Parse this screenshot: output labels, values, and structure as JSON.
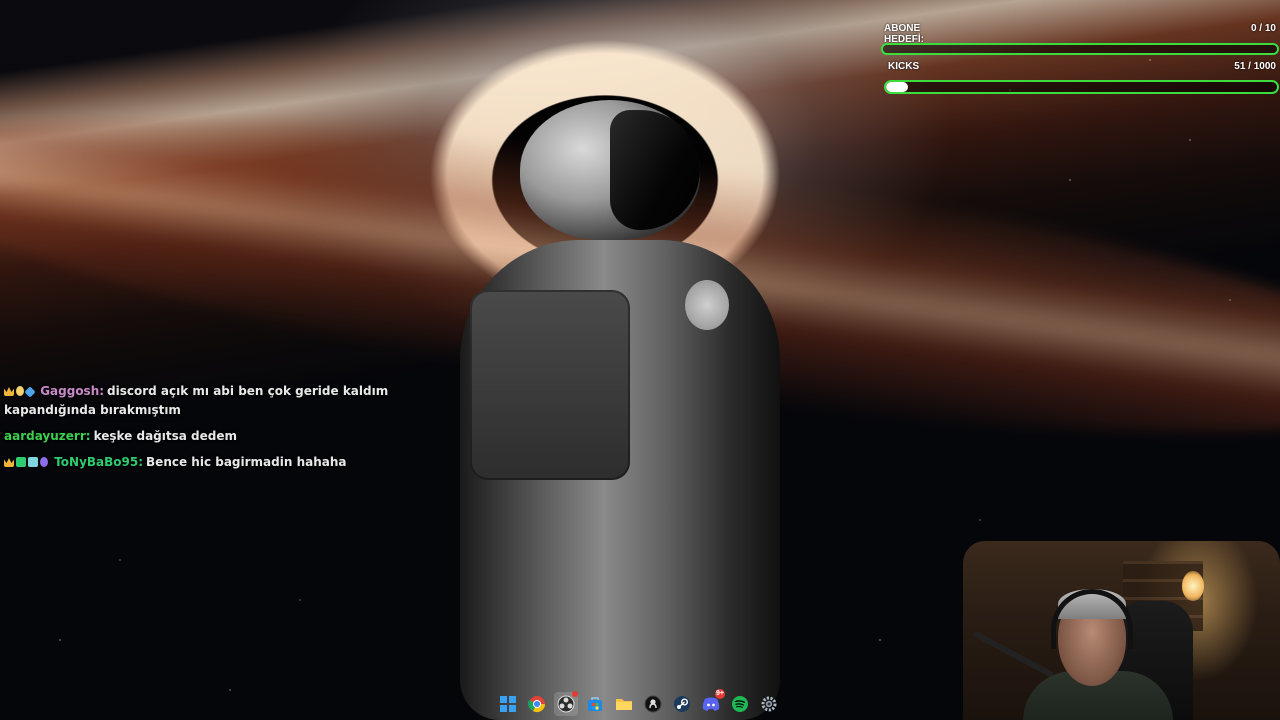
{
  "goals": [
    {
      "label": "ABONE HEDEFİ:",
      "count": "0 / 10",
      "progress": 0.0
    },
    {
      "label": "KICKS",
      "count": "51 / 1000",
      "progress": 0.051
    }
  ],
  "chat": {
    "messages": [
      {
        "username": "Gaggosh:",
        "username_color": "#c98ac9",
        "badges": [
          "crown-icon",
          "drop-icon",
          "gem-icon"
        ],
        "text": "discord açık mı abi ben çok geride kaldım kapandığında bırakmıştım"
      },
      {
        "username": "aardayuzerr:",
        "username_color": "#3ccf4e",
        "badges": [],
        "text": "keşke dağıtsa dedem"
      },
      {
        "username": "ToNyBaBo95:",
        "username_color": "#2ecc71",
        "badges": [
          "crown-icon",
          "moderator-icon",
          "subscriber-icon",
          "chip-icon"
        ],
        "text": "Bence hic bagirmadin hahaha"
      }
    ]
  },
  "taskbar": {
    "items": [
      {
        "name": "windows-start-icon",
        "active": false
      },
      {
        "name": "chrome-icon",
        "active": false
      },
      {
        "name": "obs-icon",
        "active": true
      },
      {
        "name": "store-icon",
        "active": false
      },
      {
        "name": "file-explorer-icon",
        "active": false
      },
      {
        "name": "github-icon",
        "active": false
      },
      {
        "name": "steam-icon",
        "active": false
      },
      {
        "name": "discord-icon",
        "active": false,
        "badge": "9+"
      },
      {
        "name": "spotify-icon",
        "active": false
      },
      {
        "name": "settings-icon",
        "active": false
      }
    ]
  },
  "colors": {
    "goal_border": "#3ddc3d",
    "goal_fill": "#ffffff"
  }
}
